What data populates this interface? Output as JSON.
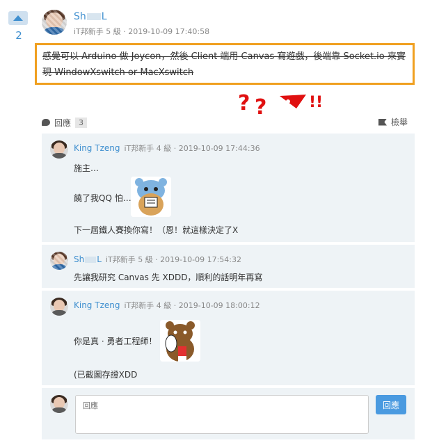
{
  "vote": {
    "count": "2"
  },
  "main": {
    "user_prefix": "Sh",
    "user_suffix": "L",
    "meta": "iT邦新手 5 級 · 2019-10-09 17:40:58",
    "text": "感覺可以 Arduino 做 Joycon，然後 Client 端用 Canvas 寫遊戲，後端靠 Socket.io 來實現 WindowXswitch or MacXswitch"
  },
  "reply_bar": {
    "label": "回應",
    "count": "3",
    "report": "檢舉"
  },
  "comments": [
    {
      "user": "King Tzeng",
      "meta": "iT邦新手 4 級 · 2019-10-09 17:44:36",
      "lines": [
        "施主…",
        "饒了我QQ 怕…",
        "下一屆鐵人賽換你寫！（恩！就這樣決定了X"
      ]
    },
    {
      "user_prefix": "Sh",
      "user_suffix": "L",
      "meta": "iT邦新手 5 級 · 2019-10-09 17:54:32",
      "lines": [
        "先讓我研究 Canvas 先 XDDD，順利的話明年再寫"
      ]
    },
    {
      "user": "King Tzeng",
      "meta": "iT邦新手 4 級 · 2019-10-09 18:00:12",
      "lines": [
        "你是真 · 勇者工程師！",
        "(已截圖存證XDD"
      ]
    }
  ],
  "input": {
    "placeholder": "回應",
    "button": "回應"
  },
  "icons": {
    "vote": "upvote-arrow-icon",
    "reply": "comment-bubble-icon",
    "report": "flag-icon"
  },
  "colors": {
    "accent": "#3f8fcf",
    "highlight": "#f0a020",
    "comment_bg": "#eef3f6",
    "button": "#4a9ae0"
  }
}
